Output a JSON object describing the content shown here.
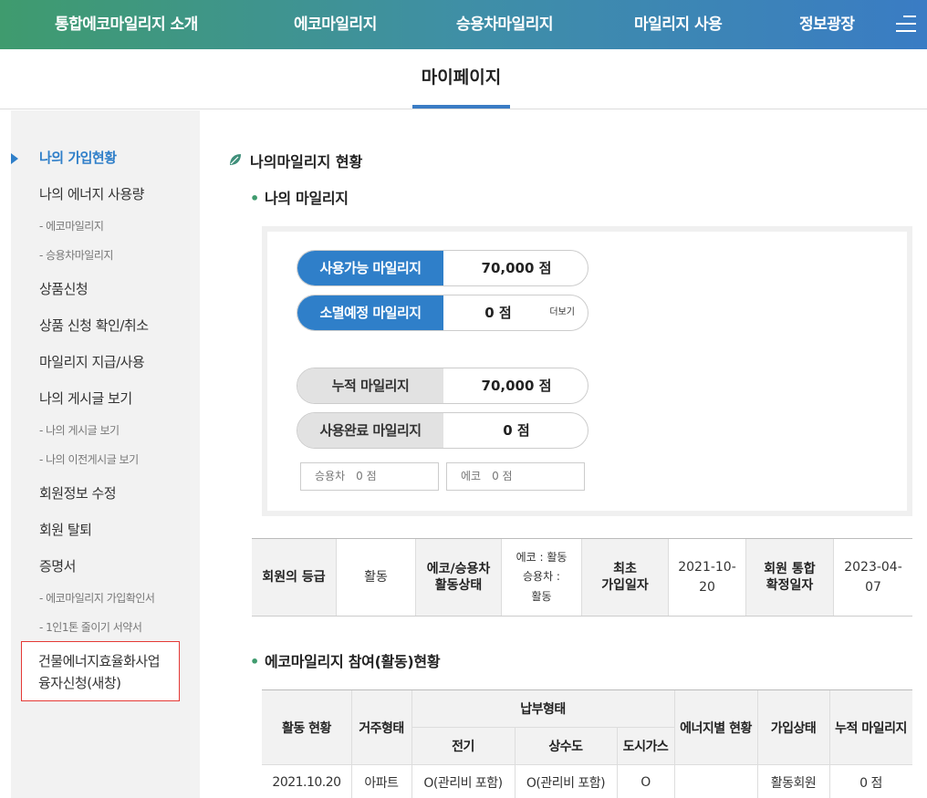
{
  "nav": {
    "items": [
      "통합에코마일리지 소개",
      "에코마일리지",
      "승용차마일리지",
      "마일리지 사용",
      "정보광장"
    ]
  },
  "page": {
    "title": "마이페이지"
  },
  "sidebar": {
    "items": [
      {
        "label": "나의 가입현황",
        "active": true
      },
      {
        "label": "나의 에너지 사용량"
      },
      {
        "label": "- 에코마일리지",
        "sub": true
      },
      {
        "label": "- 승용차마일리지",
        "sub": true
      },
      {
        "label": "상품신청"
      },
      {
        "label": "상품 신청 확인/취소"
      },
      {
        "label": "마일리지 지급/사용"
      },
      {
        "label": "나의 게시글 보기"
      },
      {
        "label": "- 나의 게시글 보기",
        "sub": true
      },
      {
        "label": "- 나의 이전게시글 보기",
        "sub": true
      },
      {
        "label": "회원정보 수정"
      },
      {
        "label": "회원 탈퇴"
      },
      {
        "label": "증명서"
      },
      {
        "label": "- 에코마일리지 가입확인서",
        "sub": true
      },
      {
        "label": "- 1인1톤 줄이기 서약서",
        "sub": true
      }
    ],
    "highlight_box": {
      "line1": "건물에너지효율화사업",
      "line2": "융자신청(새창)"
    }
  },
  "main": {
    "section_title": "나의마일리지 현황",
    "my_mileage_title": "나의 마일리지",
    "available": {
      "label": "사용가능 마일리지",
      "value": "70,000 점"
    },
    "expiring": {
      "label": "소멸예정 마일리지",
      "value": "0 점",
      "more": "더보기"
    },
    "accumulated": {
      "label": "누적 마일리지",
      "value": "70,000 점"
    },
    "used": {
      "label": "사용완료 마일리지",
      "value": "0 점"
    },
    "car": {
      "label": "승용차",
      "value": "0 점"
    },
    "eco": {
      "label": "에코",
      "value": "0 점"
    },
    "info": {
      "grade_label": "회원의 등급",
      "grade_value": "활동",
      "status_label_1": "에코/승용차",
      "status_label_2": "활동상태",
      "status_value_1": "에코 : 활동",
      "status_value_2": "승용차 :",
      "status_value_3": "활동",
      "first_join_label_1": "최초",
      "first_join_label_2": "가입일자",
      "first_join_value_1": "2021-10-",
      "first_join_value_2": "20",
      "confirm_label_1": "회원 통합",
      "confirm_label_2": "확정일자",
      "confirm_value_1": "2023-04-",
      "confirm_value_2": "07"
    },
    "participation_title": "에코마일리지 참여(활동)현황",
    "participation": {
      "headers": {
        "activity": "활동 현황",
        "residence": "거주형태",
        "payment": "납부형태",
        "electric": "전기",
        "water": "상수도",
        "gas": "도시가스",
        "energy": "에너지별 현황",
        "join_status": "가입상태",
        "accum": "누적 마일리지"
      },
      "row": {
        "activity": "2021.10.20",
        "residence": "아파트",
        "electric": "O(관리비 포함)",
        "water": "O(관리비 포함)",
        "gas": "O",
        "energy": "",
        "join_status": "활동회원",
        "accum": "0 점"
      }
    }
  },
  "colors": {
    "nav_start": "#3f9b6e",
    "nav_end": "#3a7cc4",
    "accent_blue": "#2f7fc9",
    "highlight_red": "#e53935"
  }
}
